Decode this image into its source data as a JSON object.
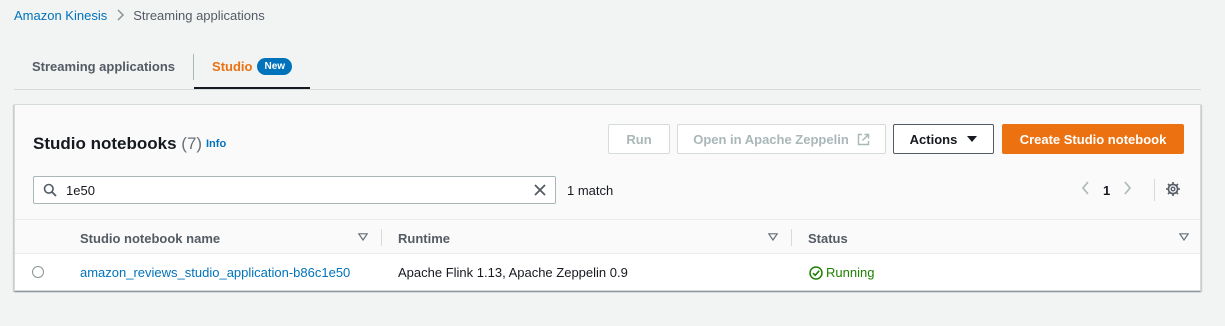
{
  "breadcrumb": {
    "root": "Amazon Kinesis",
    "current": "Streaming applications"
  },
  "tabs": [
    {
      "label": "Streaming applications",
      "active": false
    },
    {
      "label": "Studio",
      "badge": "New",
      "active": true
    }
  ],
  "panel": {
    "title": "Studio notebooks",
    "count": "(7)",
    "info": "Info",
    "buttons": {
      "run": "Run",
      "open_zeppelin": "Open in Apache Zeppelin",
      "actions": "Actions",
      "create": "Create Studio notebook"
    },
    "search": {
      "value": "1e50",
      "placeholder": ""
    },
    "match_text": "1 match",
    "pagination": {
      "current_page": "1"
    },
    "columns": [
      "Studio notebook name",
      "Runtime",
      "Status"
    ],
    "rows": [
      {
        "name": "amazon_reviews_studio_application-b86c1e50",
        "runtime": "Apache Flink 1.13, Apache Zeppelin 0.9",
        "status": "Running"
      }
    ]
  },
  "icons": {
    "breadcrumb_separator": "chevron-right-icon",
    "external": "external-link-icon",
    "caret": "caret-down-icon",
    "search": "search-icon",
    "clear": "close-icon",
    "prev": "chevron-left-icon",
    "next": "chevron-right-icon",
    "settings": "gear-icon",
    "sort": "sort-caret-icon",
    "status": "check-circle-icon"
  },
  "colors": {
    "link": "#0073bb",
    "accent": "#ec7211",
    "success": "#1d8102",
    "background": "#f2f3f3"
  }
}
